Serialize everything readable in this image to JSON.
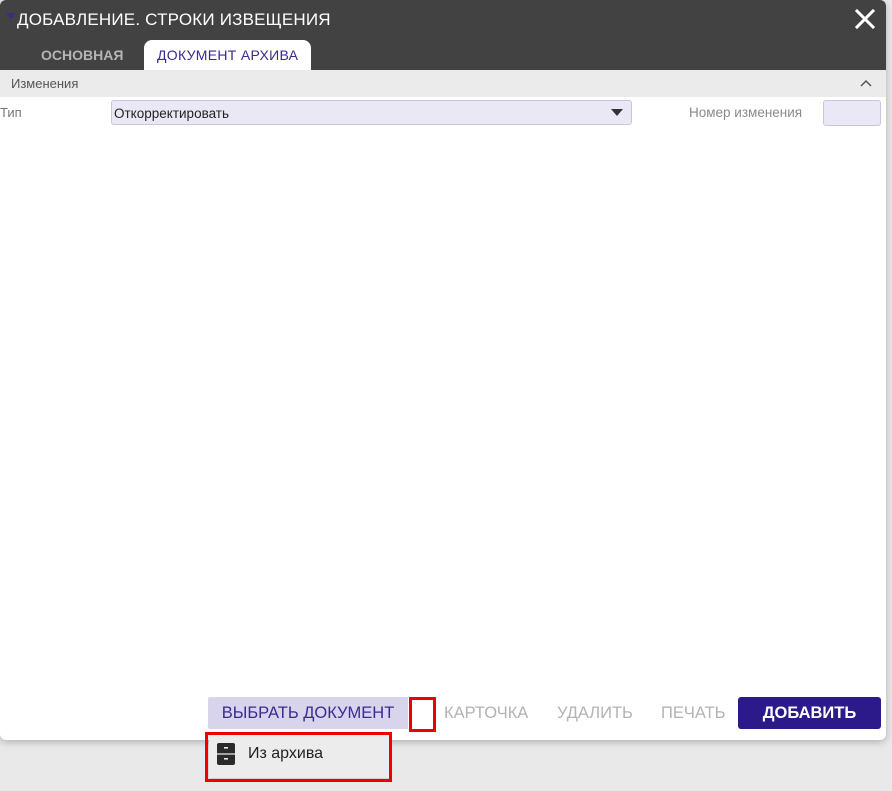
{
  "dialog": {
    "title": "ДОБАВЛЕНИЕ. СТРОКИ ИЗВЕЩЕНИЯ",
    "close_icon": "close-icon"
  },
  "tabs": [
    {
      "label": "ОСНОВНАЯ",
      "active": false
    },
    {
      "label": "ДОКУМЕНТ АРХИВА",
      "active": true
    }
  ],
  "section": {
    "title": "Изменения",
    "collapse_icon": "chevron-up-icon"
  },
  "form": {
    "type_label": "Тип",
    "type_value": "Откорректировать",
    "change_number_label": "Номер изменения",
    "change_number_value": ""
  },
  "toolbar": {
    "select_document": "ВЫБРАТЬ ДОКУМЕНТ",
    "card": "КАРТОЧКА",
    "delete": "УДАЛИТЬ",
    "print": "ПЕЧАТЬ",
    "add": "ДОБАВИТЬ"
  },
  "dropdown_menu": {
    "items": [
      {
        "label": "Из архива",
        "icon": "archive-cabinet-icon"
      }
    ]
  },
  "colors": {
    "header": "#424242",
    "accent": "#2d1a8a",
    "input_bg": "#ebe8f5",
    "highlight": "#ee0000"
  }
}
